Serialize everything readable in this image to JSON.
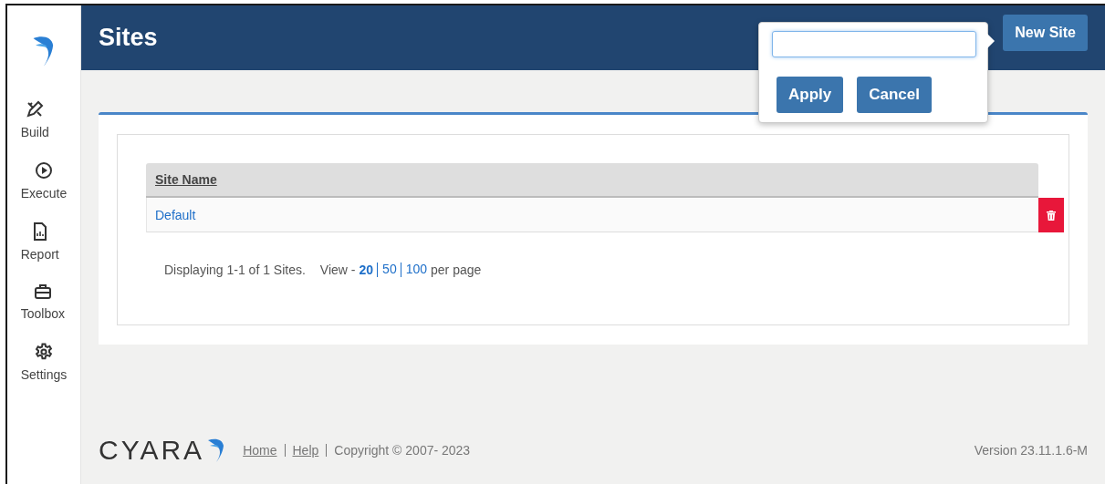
{
  "sidebar": {
    "items": [
      {
        "label": "Build"
      },
      {
        "label": "Execute"
      },
      {
        "label": "Report"
      },
      {
        "label": "Toolbox"
      },
      {
        "label": "Settings"
      }
    ]
  },
  "header": {
    "title": "Sites",
    "new_button": "New Site"
  },
  "popover": {
    "buttons": [
      "Apply",
      "Cancel"
    ]
  },
  "table": {
    "columns": [
      "Site Name"
    ],
    "rows": [
      {
        "name": "Default"
      }
    ]
  },
  "pagination": {
    "summary": "Displaying 1-1 of 1 Sites.",
    "view_label": "View -",
    "page_sizes": [
      {
        "label": "20",
        "selected": true
      },
      {
        "label": "50",
        "selected": false
      },
      {
        "label": "100",
        "selected": false
      }
    ],
    "suffix": "per page"
  },
  "footer": {
    "logo_text": "CYARA",
    "links": [
      "Home",
      "Help"
    ],
    "copyright": "Copyright © 2007- 2023",
    "version": "Version 23.11.1.6-M"
  }
}
